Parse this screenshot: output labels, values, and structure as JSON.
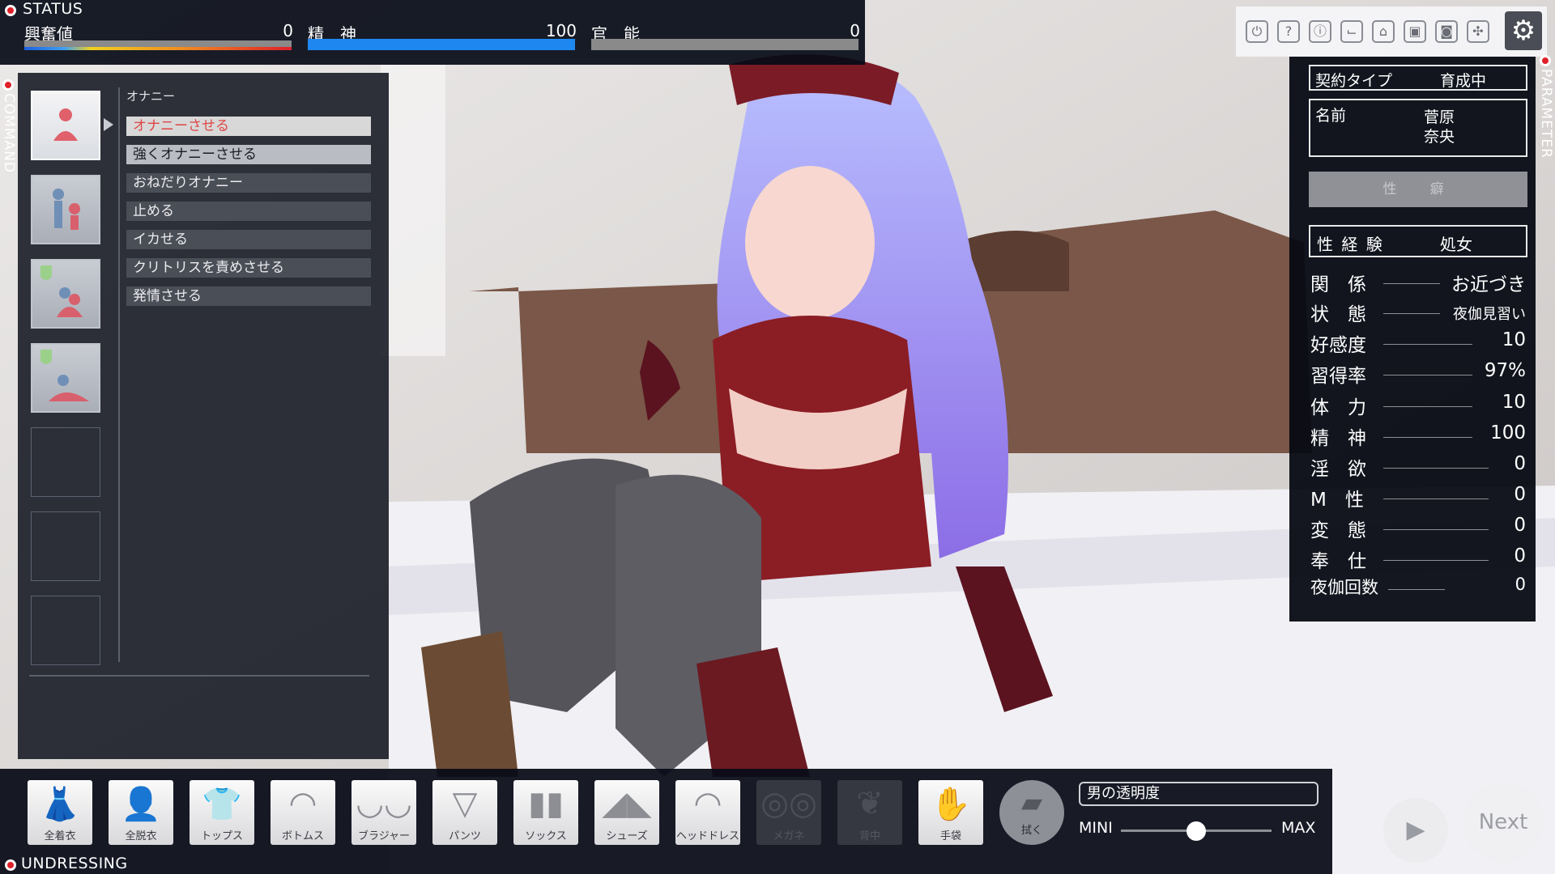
{
  "status": {
    "title": "STATUS",
    "meters": [
      {
        "label": "興奮値",
        "value": "0",
        "fill": 1.0,
        "kind": "gradient"
      },
      {
        "label": "精　神",
        "value": "100",
        "fill": 1.0,
        "color": "#1e88f0"
      },
      {
        "label": "官　能",
        "value": "0",
        "fill": 0.0,
        "color": "#1e88f0"
      }
    ]
  },
  "command": {
    "title": "COMMAND",
    "category": "オナニー",
    "items": [
      "オナニーさせる",
      "強くオナニーさせる",
      "おねだりオナニー",
      "止める",
      "イカせる",
      "クリトリスを責めさせる",
      "発情させる"
    ]
  },
  "toolbar": {
    "icons": [
      "power-icon",
      "help-icon",
      "info-icon",
      "chair-icon",
      "basket-icon",
      "portrait-icon",
      "camera-icon",
      "puzzle-icon",
      "gear-icon"
    ],
    "glyphs": [
      "⏻",
      "?",
      "ⓘ",
      "⌙",
      "⌂",
      "▣",
      "◙",
      "✣",
      "⚙"
    ]
  },
  "parameter": {
    "title": "PARAMETER",
    "contract_label": "契約タイプ",
    "contract_value": "育成中",
    "name_label": "名前",
    "name_line1": "菅原",
    "name_line2": "奈央",
    "disabled_label": "性　癖",
    "experience_label": "性 経 験",
    "experience_value": "処女",
    "rows": [
      {
        "label": "関　係",
        "value": "お近づき"
      },
      {
        "label": "状　態",
        "value": "夜伽見習い"
      },
      {
        "label": "好感度",
        "value": "10"
      },
      {
        "label": "習得率",
        "value": "97%"
      },
      {
        "label": "体　力",
        "value": "10"
      },
      {
        "label": "精　神",
        "value": "100"
      },
      {
        "label": "淫　欲",
        "value": "0"
      },
      {
        "label": "M　性",
        "value": "0"
      },
      {
        "label": "変　態",
        "value": "0"
      },
      {
        "label": "奉　仕",
        "value": "0"
      },
      {
        "label": "夜伽回数",
        "value": "0"
      }
    ]
  },
  "undressing": {
    "title": "UNDRESSING",
    "buttons": [
      {
        "label": "全着衣",
        "glyph": "👗",
        "enabled": true
      },
      {
        "label": "全脱衣",
        "glyph": "👤",
        "enabled": true
      },
      {
        "label": "トップス",
        "glyph": "👕",
        "enabled": true
      },
      {
        "label": "ボトムス",
        "glyph": "◠",
        "enabled": true
      },
      {
        "label": "ブラジャー",
        "glyph": "◡◡",
        "enabled": true
      },
      {
        "label": "パンツ",
        "glyph": "▽",
        "enabled": true
      },
      {
        "label": "ソックス",
        "glyph": "▮▮",
        "enabled": true
      },
      {
        "label": "シューズ",
        "glyph": "◢◣",
        "enabled": true
      },
      {
        "label": "ヘッドドレス",
        "glyph": "◜◝",
        "enabled": true
      },
      {
        "label": "メガネ",
        "glyph": "◎◎",
        "enabled": false
      },
      {
        "label": "背中",
        "glyph": "❦",
        "enabled": false
      },
      {
        "label": "手袋",
        "glyph": "✋",
        "enabled": true
      }
    ],
    "wipe_label": "拭く",
    "transparency_label": "男の透明度",
    "slider_min": "MINI",
    "slider_max": "MAX",
    "slider_value": 0.5
  },
  "next_label": "Next"
}
